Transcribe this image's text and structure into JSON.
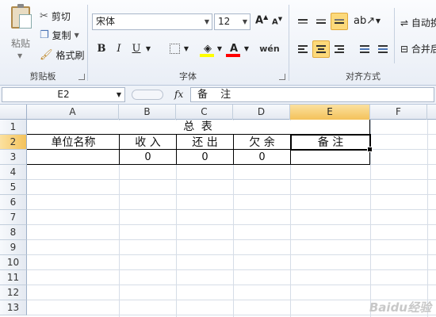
{
  "ribbon": {
    "clipboard": {
      "paste_label": "粘贴",
      "cut_label": "剪切",
      "copy_label": "复制",
      "format_painter_label": "格式刷",
      "group_label": "剪贴板"
    },
    "font": {
      "font_name": "宋体",
      "font_size": "12",
      "bold_label": "B",
      "italic_label": "I",
      "underline_label": "U",
      "grow_label": "A",
      "shrink_label": "A",
      "color_label": "A",
      "phonetic_label": "wén",
      "group_label": "字体",
      "fill_color": "#ffff00",
      "font_color": "#ff0000"
    },
    "alignment": {
      "wrap_label": "自动换",
      "merge_label": "合并后",
      "group_label": "对齐方式"
    }
  },
  "formula_bar": {
    "name_box": "E2",
    "fx_label": "fx",
    "content": "备 注"
  },
  "sheet": {
    "columns": [
      "A",
      "B",
      "C",
      "D",
      "E",
      "F"
    ],
    "selected_column": "E",
    "rows": [
      "1",
      "2",
      "3",
      "4",
      "5",
      "6",
      "7",
      "8",
      "9",
      "10",
      "11",
      "12",
      "13"
    ],
    "selected_row": "2",
    "title": "总  表",
    "headers": {
      "a": "单位名称",
      "b": "收  入",
      "c": "还  出",
      "d": "欠  余",
      "e": "备    注"
    },
    "row3": {
      "b": "0",
      "c": "0",
      "d": "0"
    }
  },
  "watermark": "Baidu经验"
}
